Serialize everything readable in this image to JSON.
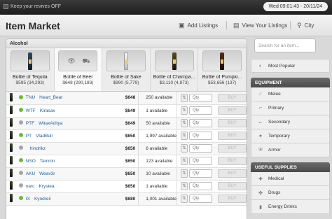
{
  "topbar": {
    "revive_toggle_label": "Keep your revives OFF",
    "clock": "Wed 09:01:43 - 20/11/24"
  },
  "header": {
    "title": "Item Market",
    "add_listings": "Add Listings",
    "view_listings": "View Your Listings",
    "city": "City"
  },
  "category": "Alcohol",
  "items": [
    {
      "name": "Bottle of Tequila",
      "price": "$595",
      "count": "(34,293)"
    },
    {
      "name": "Bottle of Beer",
      "price": "$648",
      "count": "(290,183)"
    },
    {
      "name": "Bottle of Sake",
      "price": "$990",
      "count": "(5,779)"
    },
    {
      "name": "Bottle of Champa...",
      "price": "$3,110",
      "count": "(4,873)"
    },
    {
      "name": "Bottle of Pumpki...",
      "price": "$53,656",
      "count": "(137)"
    }
  ],
  "listings": [
    {
      "status": "green",
      "tag": "TNU",
      "seller": "Heart_Beat",
      "price": "$648",
      "available": "250 available"
    },
    {
      "status": "green",
      "tag": "WTF",
      "seller": "Kirasax",
      "price": "$649",
      "available": "1 available"
    },
    {
      "status": "grey",
      "tag": "PTF",
      "seller": "WitaxAditya",
      "price": "$649",
      "available": "50 available"
    },
    {
      "status": "green",
      "tag": "PT",
      "seller": "VladBull",
      "price": "$650",
      "available": "1,997 available"
    },
    {
      "status": "grey",
      "tag": "",
      "seller": "hindrikz",
      "price": "$650",
      "available": "6 available"
    },
    {
      "status": "green",
      "tag": "NSO",
      "seller": "Tamron",
      "price": "$650",
      "available": "123 available"
    },
    {
      "status": "grey",
      "tag": "AKU",
      "seller": "Weav3r",
      "price": "$650",
      "available": "10 available"
    },
    {
      "status": "grey",
      "tag": "narc",
      "seller": "Krystea",
      "price": "$650",
      "available": "1 available"
    },
    {
      "status": "green",
      "tag": "IX",
      "seller": "Kyndreil",
      "price": "$680",
      "available": "1,001 available"
    }
  ],
  "qty_placeholder": "Qty",
  "buy_label": "BUY",
  "sidebar": {
    "search_placeholder": "Search for an item...",
    "most_popular": "Most Popular",
    "equipment_header": "EQUIPMENT",
    "equipment": [
      "Melee",
      "Primary",
      "Secondary",
      "Temporary",
      "Armor"
    ],
    "supplies_header": "USEFUL SUPPLIES",
    "supplies": [
      "Medical",
      "Drugs",
      "Energy Drinks"
    ]
  }
}
